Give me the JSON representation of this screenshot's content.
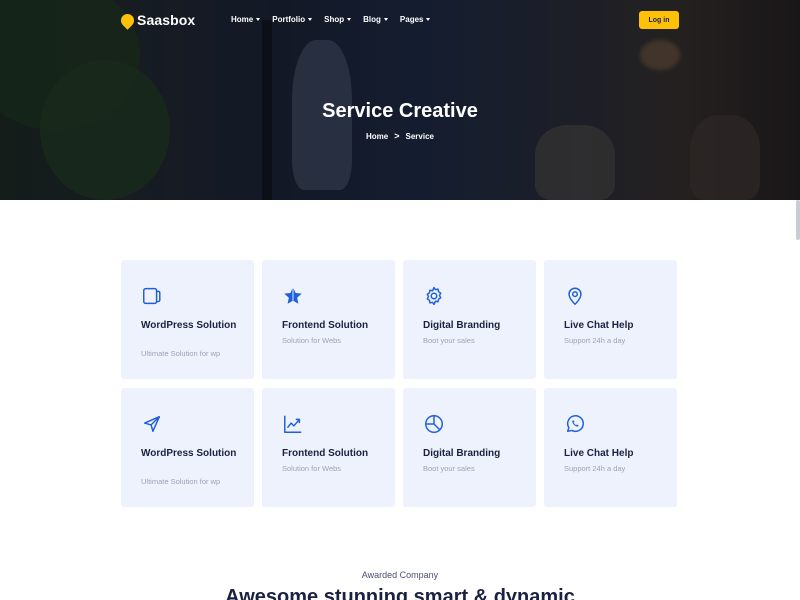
{
  "brand": {
    "name": "Saasbox",
    "accent": "#ffc107"
  },
  "nav": {
    "items": [
      {
        "label": "Home"
      },
      {
        "label": "Portfolio"
      },
      {
        "label": "Shop"
      },
      {
        "label": "Blog"
      },
      {
        "label": "Pages"
      }
    ],
    "login_label": "Log in"
  },
  "hero": {
    "title": "Service Creative",
    "breadcrumb": {
      "home": "Home",
      "separator": ">",
      "current": "Service"
    }
  },
  "services": [
    {
      "icon": "document-icon",
      "title": "WordPress Solution",
      "subtitle": "Ultimate Solution for wp"
    },
    {
      "icon": "star-icon",
      "title": "Frontend Solution",
      "subtitle": "Solution for Webs"
    },
    {
      "icon": "gear-icon",
      "title": "Digital Branding",
      "subtitle": "Boot your sales"
    },
    {
      "icon": "location-pin-icon",
      "title": "Live Chat Help",
      "subtitle": "Support 24h a day"
    },
    {
      "icon": "send-icon",
      "title": "WordPress Solution",
      "subtitle": "Ultimate Solution for wp"
    },
    {
      "icon": "trend-chart-icon",
      "title": "Frontend Solution",
      "subtitle": "Solution for Webs"
    },
    {
      "icon": "pie-chart-icon",
      "title": "Digital Branding",
      "subtitle": "Boot your sales"
    },
    {
      "icon": "whatsapp-icon",
      "title": "Live Chat Help",
      "subtitle": "Support 24h a day"
    }
  ],
  "section": {
    "eyebrow": "Awarded Company",
    "headline": "Awesome stunning smart & dynamic"
  },
  "colors": {
    "icon": "#1f5fd8",
    "card_bg": "#eef2fc",
    "text_dark": "#1b2140",
    "text_muted": "#9aa3bd"
  }
}
